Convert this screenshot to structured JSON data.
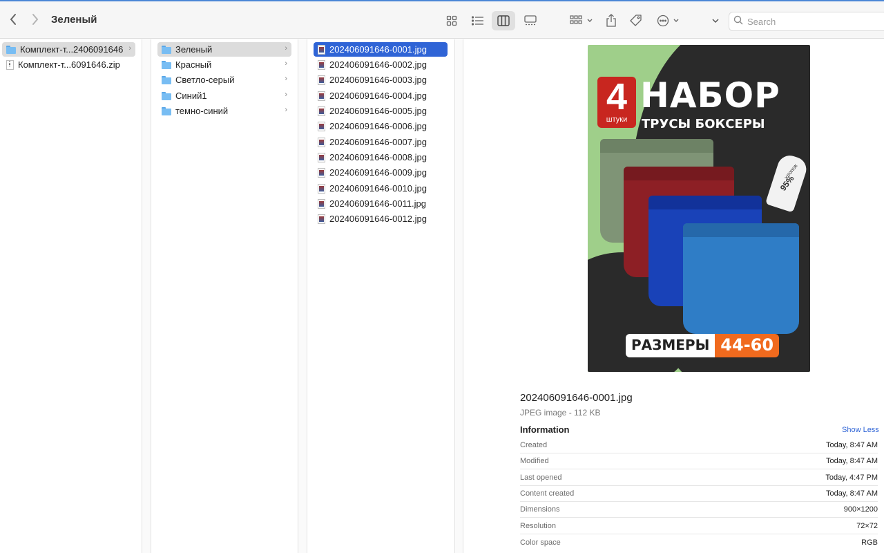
{
  "window": {
    "title": "Зеленый"
  },
  "toolbar": {
    "icons": [
      "chevron-left-icon",
      "chevron-right-icon",
      "icon-view-icon",
      "list-view-icon",
      "column-view-icon",
      "gallery-view-icon",
      "group-icon",
      "share-icon",
      "tag-icon",
      "more-icon",
      "chevron-down-icon",
      "search-icon"
    ],
    "search_placeholder": "Search"
  },
  "column1": [
    {
      "label": "Комплект-т...2406091646",
      "type": "folder",
      "selected": true
    },
    {
      "label": "Комплект-т...6091646.zip",
      "type": "zip",
      "selected": false
    }
  ],
  "column2": [
    {
      "label": "Зеленый",
      "selected": true
    },
    {
      "label": "Красный",
      "selected": false
    },
    {
      "label": "Светло-серый",
      "selected": false
    },
    {
      "label": "Синий1",
      "selected": false
    },
    {
      "label": "темно-синий",
      "selected": false
    }
  ],
  "column3": [
    "202406091646-0001.jpg",
    "202406091646-0002.jpg",
    "202406091646-0003.jpg",
    "202406091646-0004.jpg",
    "202406091646-0005.jpg",
    "202406091646-0006.jpg",
    "202406091646-0007.jpg",
    "202406091646-0008.jpg",
    "202406091646-0009.jpg",
    "202406091646-0010.jpg",
    "202406091646-0011.jpg",
    "202406091646-0012.jpg"
  ],
  "preview": {
    "badge_number": "4",
    "badge_sub": "штуки",
    "headline": "НАБОР",
    "subline": "ТРУСЫ БОКСЕРЫ",
    "tag_line1": "хлопок",
    "tag_line2": "95%",
    "sizes_label": "РАЗМЕРЫ",
    "sizes_value": "44-60",
    "colors": {
      "background": "#9fcf8a",
      "dark": "#2a2a2a",
      "badge": "#c8261f",
      "sizes": "#f06a1e"
    }
  },
  "file": {
    "name": "202406091646-0001.jpg",
    "kind": "JPEG image - 112 KB",
    "info_title": "Information",
    "show_less": "Show Less",
    "rows": [
      {
        "key": "Created",
        "value": "Today, 8:47 AM"
      },
      {
        "key": "Modified",
        "value": "Today, 8:47 AM"
      },
      {
        "key": "Last opened",
        "value": "Today, 4:47 PM"
      },
      {
        "key": "Content created",
        "value": "Today, 8:47 AM"
      },
      {
        "key": "Dimensions",
        "value": "900×1200"
      },
      {
        "key": "Resolution",
        "value": "72×72"
      },
      {
        "key": "Color space",
        "value": "RGB"
      }
    ]
  }
}
